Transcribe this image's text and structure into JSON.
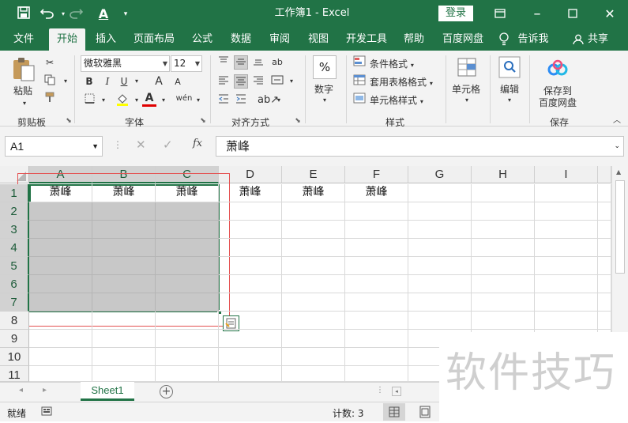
{
  "title_bar": {
    "title": "工作簿1  -  Excel",
    "login_label": "登录"
  },
  "ribbon_tabs": [
    {
      "label": "文件",
      "active": false
    },
    {
      "label": "开始",
      "active": true
    },
    {
      "label": "插入",
      "active": false
    },
    {
      "label": "页面布局",
      "active": false
    },
    {
      "label": "公式",
      "active": false
    },
    {
      "label": "数据",
      "active": false
    },
    {
      "label": "审阅",
      "active": false
    },
    {
      "label": "视图",
      "active": false
    },
    {
      "label": "开发工具",
      "active": false
    },
    {
      "label": "帮助",
      "active": false
    },
    {
      "label": "百度网盘",
      "active": false
    }
  ],
  "tell_me": "告诉我",
  "share": "共享",
  "ribbon": {
    "clipboard": {
      "paste": "粘贴",
      "group": "剪贴板"
    },
    "font": {
      "name": "微软雅黑",
      "size": "12",
      "group": "字体",
      "bold": "B",
      "italic": "I",
      "underline": "U",
      "grow": "A",
      "shrink": "A",
      "phonetic": "wén",
      "font_color": "A"
    },
    "alignment": {
      "group": "对齐方式",
      "wrap": "ab"
    },
    "number": {
      "label": "数字",
      "symbol": "%"
    },
    "styles": {
      "conditional": "条件格式",
      "table": "套用表格格式",
      "cell_styles": "单元格样式",
      "group": "样式"
    },
    "cells": {
      "label": "单元格"
    },
    "editing": {
      "label": "编辑"
    },
    "baidu": {
      "line1": "保存到",
      "line2": "百度网盘",
      "group": "保存"
    }
  },
  "formula_bar": {
    "name_box": "A1",
    "fx": "fx",
    "value": "萧峰"
  },
  "grid": {
    "columns": [
      "A",
      "B",
      "C",
      "D",
      "E",
      "F",
      "G",
      "H",
      "I"
    ],
    "rows": [
      "1",
      "2",
      "3",
      "4",
      "5",
      "6",
      "7",
      "8",
      "9",
      "10",
      "11"
    ],
    "row1_values": [
      "萧峰",
      "萧峰",
      "萧峰",
      "萧峰",
      "萧峰",
      "萧峰"
    ]
  },
  "sheet_tabs": [
    {
      "label": "Sheet1",
      "active": true
    }
  ],
  "status_bar": {
    "mode": "就绪",
    "count": "计数: 3"
  },
  "watermark": "软件技巧"
}
